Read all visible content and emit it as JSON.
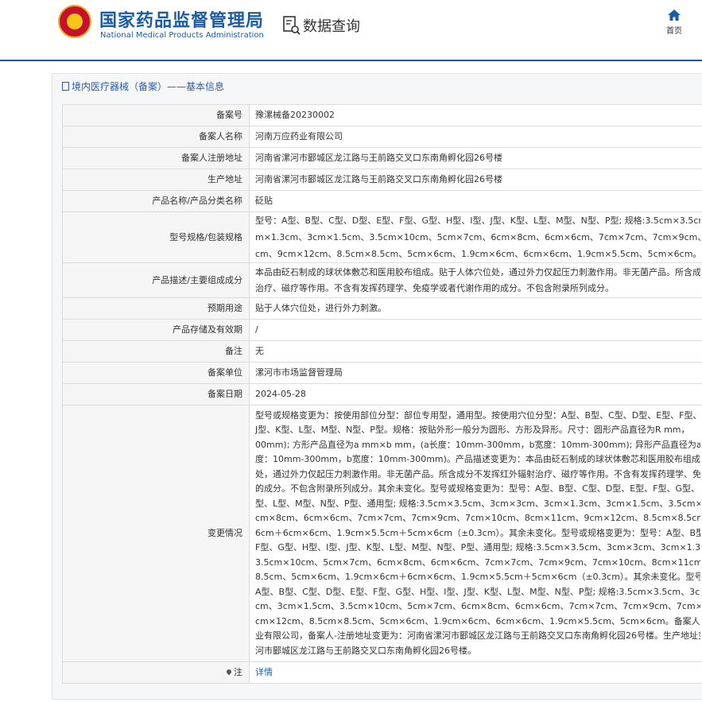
{
  "header": {
    "brand_cn": "国家药品监督管理局",
    "brand_en": "National Medical Products Administration",
    "query_label": "数据查询",
    "home_label": "首页",
    "brand_color": "#1a5ca8"
  },
  "section": {
    "title": "境内医疗器械（备案）——基本信息"
  },
  "rows": [
    {
      "key": "备案号",
      "value": "豫漯械备20230002"
    },
    {
      "key": "备案人名称",
      "value": "河南万应药业有限公司"
    },
    {
      "key": "备案人注册地址",
      "value": "河南省漯河市郾城区龙江路与王前路交叉口东南角孵化园26号楼"
    },
    {
      "key": "生产地址",
      "value": "河南省漯河市郾城区龙江路与王前路交叉口东南角孵化园26号楼"
    },
    {
      "key": "产品名称/产品分类名称",
      "value": "砭贴"
    },
    {
      "key": "型号规格/包装规格",
      "lines": [
        "型号：A型、B型、C型、D型、E型、F型、G型、H型、I型、J型、K型、L型、M型、N型、P型; 规格:3.5cm×3.5cm、",
        "m×1.3cm、3cm×1.5cm、3.5cm×10cm、5cm×7cm、6cm×8cm、6cm×6cm、7cm×7cm、7cm×9cm、7cm×",
        "cm、9cm×12cm、8.5cm×8.5cm、5cm×6cm、1.9cm×6cm、6cm×6cm、1.9cm×5.5cm、5cm×6cm。"
      ]
    },
    {
      "key": "产品描述/主要组成成分",
      "lines": [
        "本品由砭石制成的球状体敷芯和医用胶布组成。贴于人体穴位处，通过外力仅起压力刺激作用。非无菌产品。所含成分",
        "治疗、磁疗等作用。不含有发挥药理学、免疫学或者代谢作用的成分。不包含附录所列成分。"
      ]
    },
    {
      "key": "预期用途",
      "value": "贴于人体穴位处，进行外力刺激。"
    },
    {
      "key": "产品存储及有效期",
      "value": "/"
    },
    {
      "key": "备注",
      "value": "无"
    },
    {
      "key": "备案单位",
      "value": "漯河市市场监督管理局"
    },
    {
      "key": "备案日期",
      "value": "2024-05-28"
    }
  ],
  "change": {
    "key": "变更情况",
    "lines": [
      "型号或规格变更为：按使用部位分型：部位专用型，通用型。按使用穴位分型：A型、B型、C型、D型、E型、F型、G",
      "J型、K型、L型、M型、N型、P型。规格：按贴外形一般分为圆形、方形及异形。尺寸：圆形产品直径为R mm，",
      "00mm); 方形产品直径为a mm×b mm，(a长度：10mm-300mm，b宽度：10mm-300mm); 异形产品直径为a mm",
      "度：10mm-300mm，b宽度：10mm-300mm)。产品描述变更为：本品由砭石制成的球状体敷芯和医用胶布组成。",
      "处，通过外力仅起压力刺激作用。非无菌产品。所含成分不发挥红外辐射治疗、磁疗等作用。不含有发挥药理学、免",
      "的成分。不包含附录所列成分。其余未变化。型号或规格变更为：型号：A型、B型、C型、D型、E型、F型、G型、H",
      "型、L型、M型、N型、P型、通用型; 规格:3.5cm×3.5cm、3cm×3cm、3cm×1.3cm、3cm×1.5cm、3.5cm×10cm",
      "cm×8cm、6cm×6cm、7cm×7cm、7cm×9cm、7cm×10cm、8cm×11cm、9cm×12cm、8.5cm×8.5cm、5cm",
      "6cm＋6cm×6cm、1.9cm×5.5cm＋5cm×6cm（±0.3cm）。其余未变化。型号或规格变更为：型号：A型、B型、C",
      "F型、G型、H型、I型、J型、K型、L型、M型、N型、P型、通用型; 规格:3.5cm×3.5cm、3cm×3cm、3cm×1.3cm、",
      "3.5cm×10cm、5cm×7cm、6cm×8cm、6cm×6cm、7cm×7cm、7cm×9cm、7cm×10cm、8cm×11cm、9cm×",
      "8.5cm、5cm×6cm、1.9cm×6cm＋6cm×6cm、1.9cm×5.5cm＋5cm×6cm（±0.3cm）。其余未变化。型号或规格",
      "A型、B型、C型、D型、E型、F型、G型、H型、I型、J型、K型、L型、M型、N型、P型; 规格:3.5cm×3.5cm、3cm×",
      "cm、3cm×1.5cm、3.5cm×10cm、5cm×7cm、6cm×8cm、6cm×6cm、7cm×7cm、7cm×9cm、7cm×10cm、",
      "cm×12cm、8.5cm×8.5cm、5cm×6cm、1.9cm×6cm、6cm×6cm、1.9cm×5.5cm、5cm×6cm。备案人名称变更",
      "业有限公司，备案人-注册地址变更为：河南省漯河市郾城区龙江路与王前路交叉口东南角孵化园26号楼。生产地址变",
      "河市郾城区龙江路与王前路交叉口东南角孵化园26号楼。"
    ]
  },
  "note": {
    "key": "注",
    "link": "详情"
  }
}
